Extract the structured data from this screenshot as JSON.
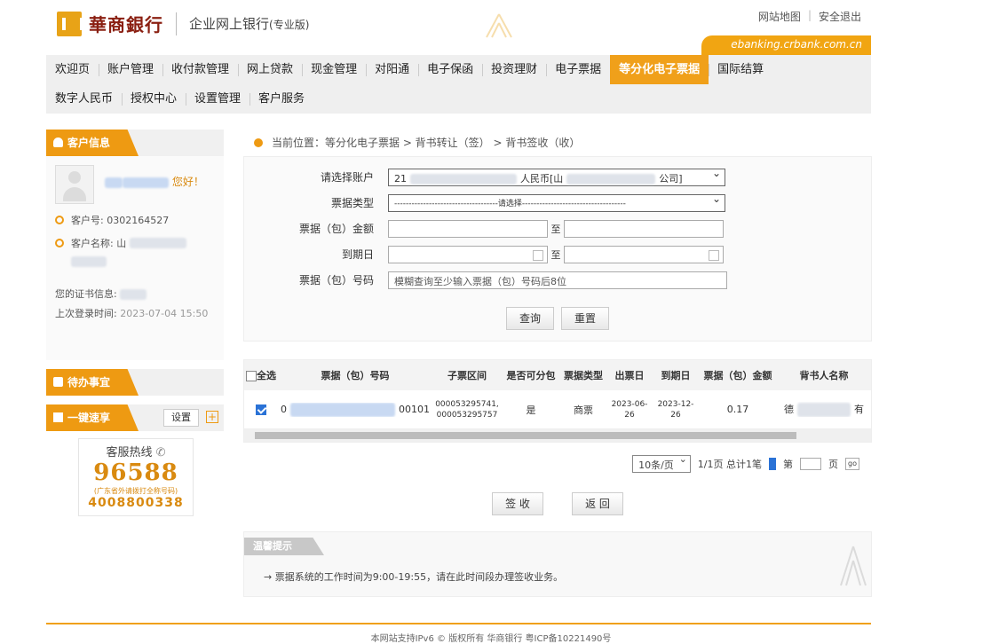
{
  "header": {
    "bank_name": "華商銀行",
    "subtitle": "企业网上银行",
    "subtitle_edition": "(专业版)",
    "links": [
      "网站地图",
      "安全退出"
    ],
    "url": "ebanking.crbank.com.cn",
    "accent_color": "#f0a01a"
  },
  "nav": {
    "row1": [
      "欢迎页",
      "账户管理",
      "收付款管理",
      "网上贷款",
      "现金管理",
      "对阳通",
      "电子保函",
      "投资理财",
      "电子票据",
      "等分化电子票据",
      "国际结算"
    ],
    "row2": [
      "数字人民币",
      "授权中心",
      "设置管理",
      "客户服务"
    ],
    "active": "等分化电子票据"
  },
  "sidebar": {
    "account_panel": {
      "title": "客户信息",
      "greeting": "您好！",
      "customer_no_label": "客户号:",
      "customer_no": "0302164527",
      "customer_name_label": "客户名称:",
      "customer_name_prefix": "山",
      "certificate_label": "您的证书信息:",
      "last_login_label": "上次登录时间:",
      "last_login": "2023-07-04 15:50"
    },
    "todo_panel": {
      "title": "待办事宜"
    },
    "quick_panel": {
      "title": "一键速享",
      "setting": "设置",
      "add": "+"
    },
    "hotline": {
      "title": "客服热线",
      "number": "96588",
      "note": "(广东省外请拨打全称号码)",
      "number2": "4008800338"
    }
  },
  "main": {
    "breadcrumb": "当前位置：等分化电子票据 > 背书转让（签） > 背书签收（收）",
    "form": {
      "account_label": "请选择账户",
      "account_value_prefix": "21",
      "account_value_mid": "人民币[山",
      "account_value_suffix": "公司]",
      "bill_type_label": "票据类型",
      "bill_type_value": "------------------------------------请选择------------------------------------",
      "amount_label": "票据（包）金额",
      "due_label": "到期日",
      "to_label": "至",
      "number_label": "票据（包）号码",
      "number_placeholder": "模糊查询至少输入票据（包）号码后8位",
      "query_btn": "查询",
      "reset_btn": "重置"
    },
    "table": {
      "headers": [
        "全选",
        "票据（包）号码",
        "子票区间",
        "是否可分包",
        "票据类型",
        "出票日",
        "到期日",
        "票据（包）金额",
        "背书人名称"
      ],
      "row": {
        "number_prefix": "0",
        "number_suffix": "00101",
        "range_start": "000053295741,",
        "range_end": "000053295757",
        "divisible": "是",
        "type": "商票",
        "issue_date": "2023-06-26",
        "due_date": "2023-12-26",
        "amount": "0.17",
        "endorser_prefix": "德",
        "endorser_suffix": "有"
      }
    },
    "pager": {
      "page_size": "10条/页",
      "page_info": "1/1页 总计1笔",
      "page_label": "第",
      "page_unit": "页",
      "go": "go"
    },
    "sign_btn": "签 收",
    "back_btn": "返 回",
    "tips": {
      "title": "温馨提示",
      "text": "→ 票据系统的工作时间为9:00-19:55，请在此时间段办理签收业务。"
    }
  },
  "footer": {
    "text": "本网站支持IPv6    © 版权所有 华商银行    粤ICP备10221490号"
  }
}
